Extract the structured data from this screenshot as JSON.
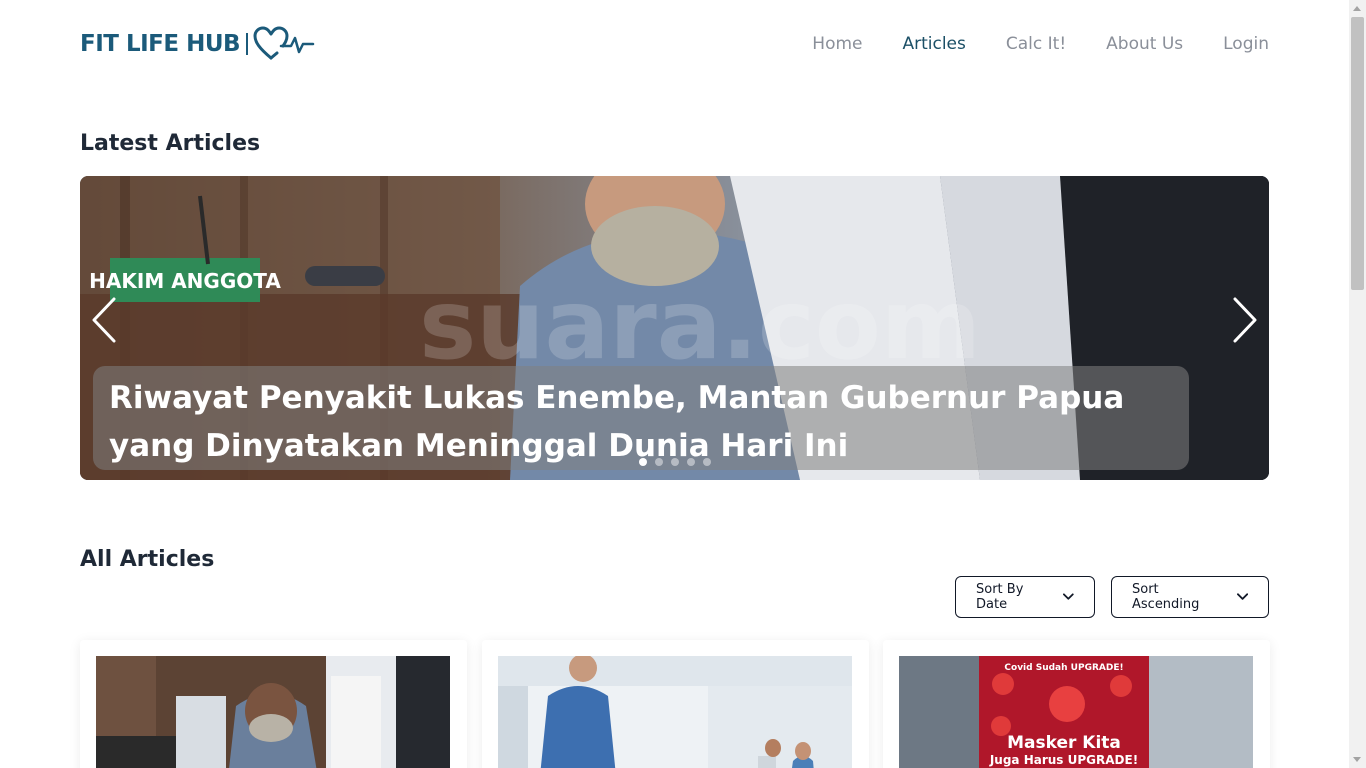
{
  "brand": {
    "name": "FIT LIFE HUB",
    "color": "#1b5a7a"
  },
  "nav": {
    "items": [
      {
        "label": "Home",
        "active": false
      },
      {
        "label": "Articles",
        "active": true
      },
      {
        "label": "Calc It!",
        "active": false
      },
      {
        "label": "About Us",
        "active": false
      },
      {
        "label": "Login",
        "active": false
      }
    ]
  },
  "latest": {
    "heading": "Latest Articles",
    "carousel": {
      "caption": "Riwayat Penyakit Lukas Enembe, Mantan Gubernur Papua yang Dinyatakan Meninggal Dunia Hari Ini",
      "slide_count": 5,
      "active_index": 0,
      "prev_icon": "chevron-left-icon",
      "next_icon": "chevron-right-icon",
      "image_texts": {
        "nameplate": "HAKIM ANGGOTA",
        "watermark": "suara.com"
      }
    }
  },
  "all": {
    "heading": "All Articles",
    "sort_by": {
      "selected": "Sort By Date",
      "icon": "chevron-down-icon"
    },
    "sort_order": {
      "selected": "Sort Ascending",
      "icon": "chevron-down-icon"
    },
    "cards": [
      {
        "image_text": ""
      },
      {
        "image_text": ""
      },
      {
        "image_text": "Covid Sudah UPGRADE! Masker Kita Juga Harus UPGRADE!"
      }
    ]
  }
}
